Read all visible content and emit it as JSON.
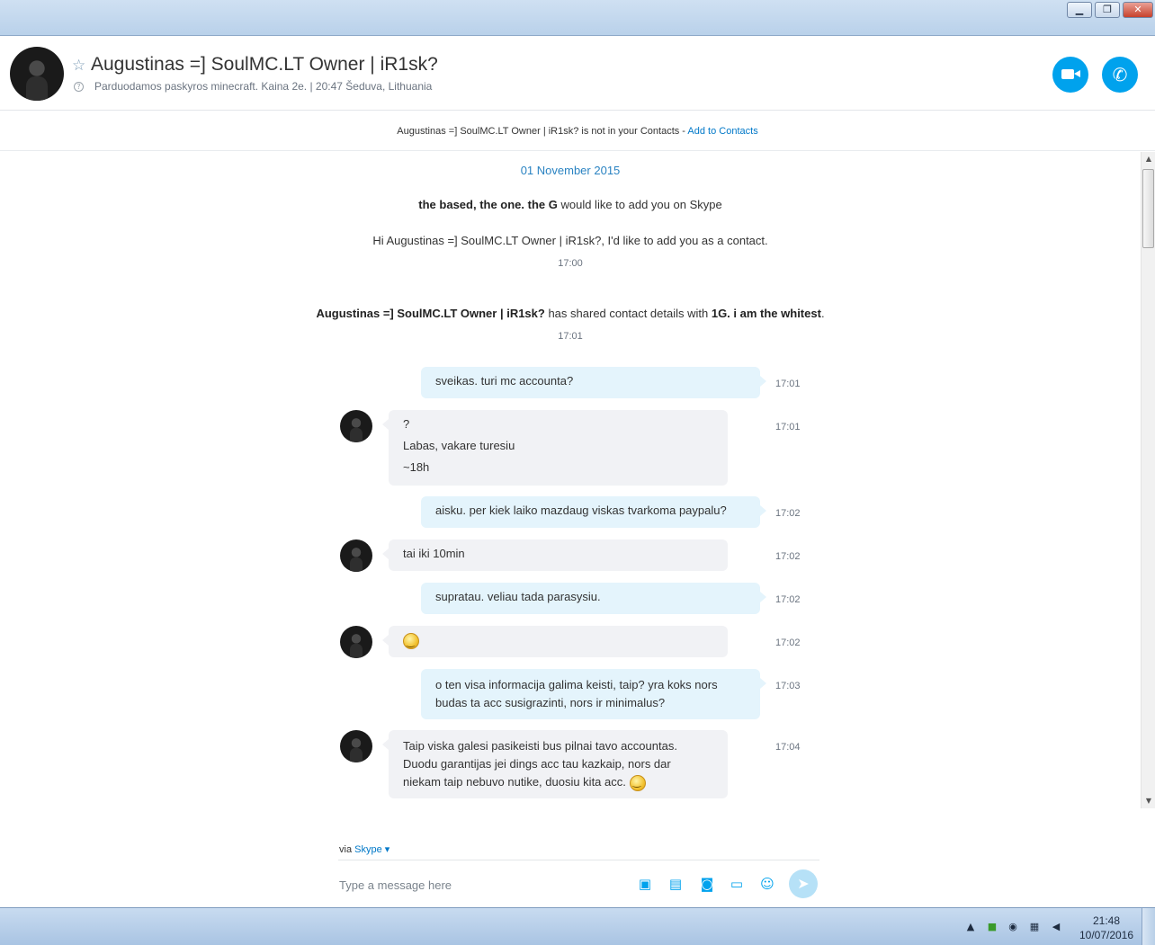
{
  "window": {
    "minimize_glyph": "▁",
    "maximize_glyph": "❐",
    "close_glyph": "✕"
  },
  "header": {
    "name": "Augustinas =] SoulMC.LT Owner | iR1sk?",
    "status": "Parduodamos paskyros minecraft. Kaina 2e.  |  20:47 Šeduva, Lithuania",
    "star_icon": "star-icon",
    "buttons": [
      "video-call-icon",
      "phone-icon"
    ]
  },
  "notice": {
    "text": "Augustinas =] SoulMC.LT Owner | iR1sk? is not in your Contacts - ",
    "link": "Add to Contacts"
  },
  "conversation": {
    "date": "01 November 2015",
    "request_bold": "the based, the one. the G",
    "request_rest": " would like to add you on Skype",
    "request_message": "Hi Augustinas =] SoulMC.LT Owner | iR1sk?, I'd like to add you as a contact.",
    "request_time": "17:00",
    "shared_name": "Augustinas =] SoulMC.LT Owner | iR1sk?",
    "shared_mid": " has shared contact details with ",
    "shared_target": "1G. i am the whitest",
    "shared_end": ".",
    "shared_time": "17:01",
    "messages": [
      {
        "dir": "out",
        "lines": [
          "sveikas. turi mc accounta?"
        ],
        "time": "17:01"
      },
      {
        "dir": "in",
        "lines": [
          "?",
          "Labas, vakare turesiu",
          "~18h"
        ],
        "time": "17:01"
      },
      {
        "dir": "out",
        "lines": [
          "aisku. per kiek laiko mazdaug viskas tvarkoma paypalu?"
        ],
        "time": "17:02"
      },
      {
        "dir": "in",
        "lines": [
          "tai iki 10min"
        ],
        "time": "17:02"
      },
      {
        "dir": "out",
        "lines": [
          "supratau. veliau tada parasysiu."
        ],
        "time": "17:02"
      },
      {
        "dir": "in",
        "lines": [],
        "emoji": "smiley-icon",
        "time": "17:02"
      },
      {
        "dir": "out",
        "lines": [
          "o ten visa informacija galima keisti, taip? yra koks nors",
          "budas ta acc susigrazinti, nors ir minimalus?"
        ],
        "time": "17:03"
      },
      {
        "dir": "in",
        "lines": [
          "Taip viska galesi pasikeisti bus pilnai tavo accountas.",
          "Duodu garantijas jei dings acc tau kazkaip, nors dar",
          "niekam taip nebuvo nutike, duosiu kita acc."
        ],
        "emoji": "smiley-icon",
        "time": "17:04"
      }
    ]
  },
  "composer": {
    "via_label": "via ",
    "via_service": "Skype",
    "placeholder": "Type a message here",
    "tools": [
      "share-media-icon",
      "send-file-icon",
      "video-message-icon",
      "send-contact-icon",
      "emoticon-icon"
    ]
  },
  "taskbar": {
    "time": "21:48",
    "date": "10/07/2016"
  },
  "colors": {
    "accent": "#00a2ed",
    "link": "#0078c8",
    "outgoing_bubble": "#e4f4fc",
    "incoming_bubble": "#f1f2f5"
  }
}
